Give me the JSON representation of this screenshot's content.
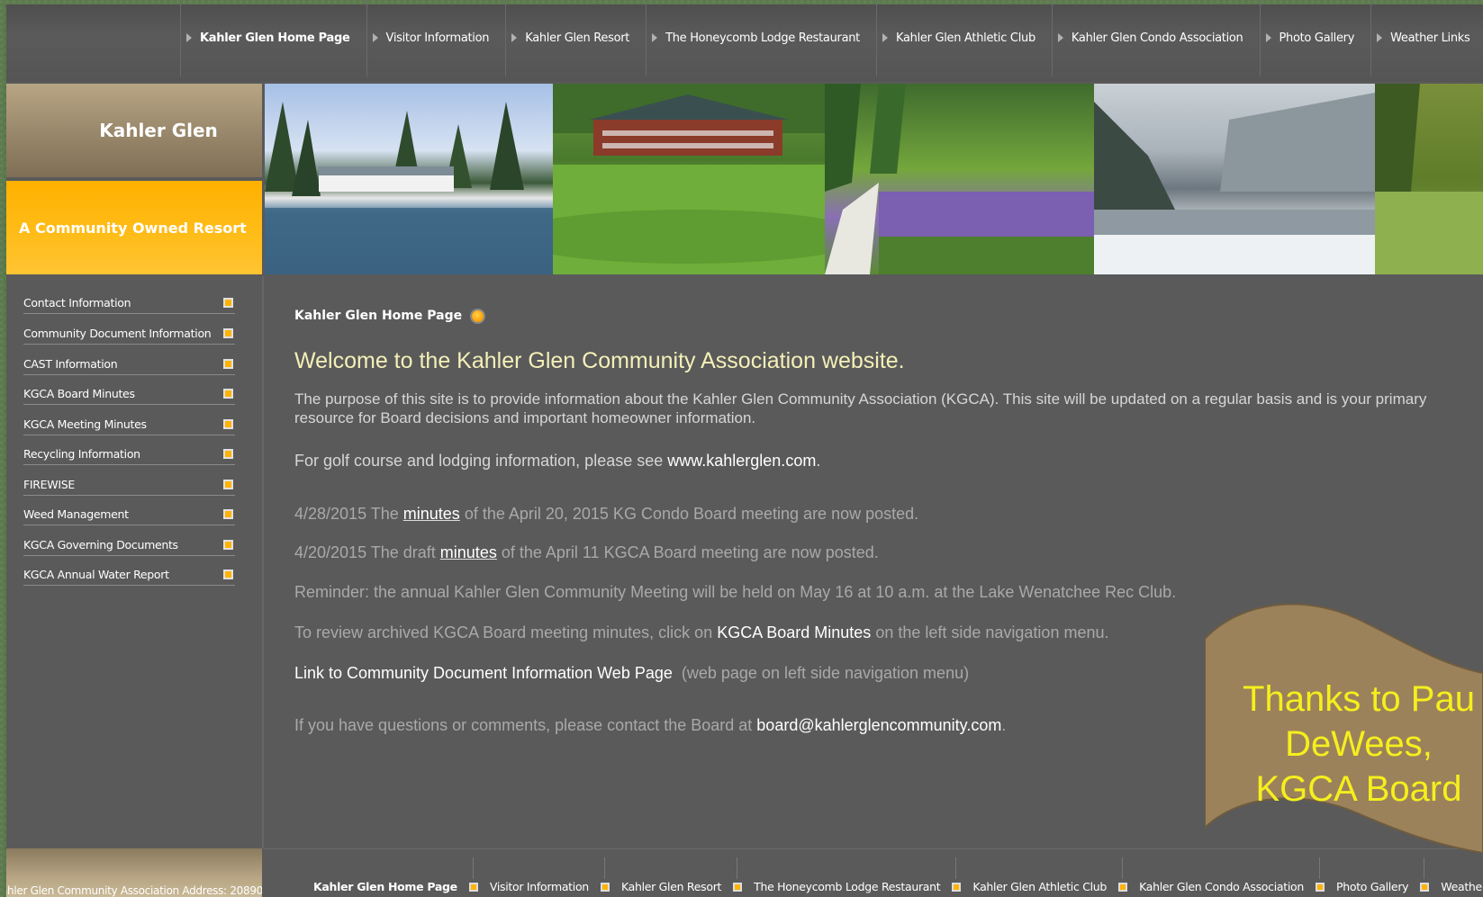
{
  "top_nav": [
    {
      "label": "Kahler Glen Home Page",
      "active": true
    },
    {
      "label": "Visitor Information",
      "active": false
    },
    {
      "label": "Kahler Glen Resort",
      "active": false
    },
    {
      "label": "The Honeycomb Lodge Restaurant",
      "active": false
    },
    {
      "label": "Kahler Glen Athletic Club",
      "active": false
    },
    {
      "label": "Kahler Glen Condo Association",
      "active": false
    },
    {
      "label": "Photo Gallery",
      "active": false
    },
    {
      "label": "Weather Links",
      "active": false
    }
  ],
  "brand": {
    "name": "Kahler Glen",
    "tagline": "A Community Owned Resort"
  },
  "sidebar": [
    {
      "label": "Contact Information"
    },
    {
      "label": "Community Document Information"
    },
    {
      "label": "CAST Information"
    },
    {
      "label": "KGCA Board Minutes"
    },
    {
      "label": "KGCA Meeting Minutes"
    },
    {
      "label": "Recycling Information"
    },
    {
      "label": "FIREWISE"
    },
    {
      "label": "Weed Management"
    },
    {
      "label": "KGCA Governing Documents"
    },
    {
      "label": "KGCA Annual Water Report"
    }
  ],
  "main": {
    "breadcrumb": "Kahler Glen Home Page",
    "welcome": "Welcome to the Kahler Glen Community Association website.",
    "intro": "The purpose of this site is to provide information about the Kahler Glen Community Association (KGCA). This site will be updated on a regular basis and is your primary resource for Board decisions and important homeowner information.",
    "golf_prefix": "For golf course and lodging information, please see ",
    "golf_link": "www.kahlerglen.com",
    "golf_suffix": ".",
    "news": [
      {
        "prefix": "4/28/2015  The ",
        "link": "minutes",
        "suffix": " of the April 20, 2015 KG Condo Board meeting are now posted."
      },
      {
        "prefix": "4/20/2015  The draft ",
        "link": "minutes",
        "suffix": " of the April 11 KGCA Board meeting are now posted."
      }
    ],
    "reminder": "Reminder: the annual Kahler Glen Community Meeting will be held on May 16 at 10 a.m. at the Lake Wenatchee Rec Club.",
    "archive_prefix": "To review archived KGCA Board meeting minutes, click on ",
    "archive_link": "KGCA Board Minutes",
    "archive_suffix": " on the left side navigation menu.",
    "doc_link": "Link to Community Document Information Web Page",
    "doc_suffix": "  (web page on left side navigation menu)",
    "contact_prefix": "If you have questions or comments, please contact the Board at ",
    "contact_link": "board@kahlerglencommunity.com",
    "contact_suffix": "."
  },
  "banner": {
    "line1": "Thanks to Pau",
    "line2": "DeWees,",
    "line3": "KGCA Board"
  },
  "footer": {
    "address": "ahler Glen Community Association Address: 20890",
    "nav": [
      {
        "label": "Kahler Glen Home Page",
        "active": true
      },
      {
        "label": "Visitor Information",
        "active": false
      },
      {
        "label": "Kahler Glen Resort",
        "active": false
      },
      {
        "label": "The Honeycomb Lodge Restaurant",
        "active": false
      },
      {
        "label": "Kahler Glen Athletic Club",
        "active": false
      },
      {
        "label": "Kahler Glen Condo Association",
        "active": false
      },
      {
        "label": "Photo Gallery",
        "active": false
      },
      {
        "label": "Weather Links",
        "active": false
      }
    ]
  },
  "colors": {
    "accent_orange": "#ffb300",
    "panel_gray": "#5a5a5a",
    "welcome_text": "#f4f0b8",
    "banner_fill": "#9c825a",
    "banner_text": "#f5ef1d"
  }
}
